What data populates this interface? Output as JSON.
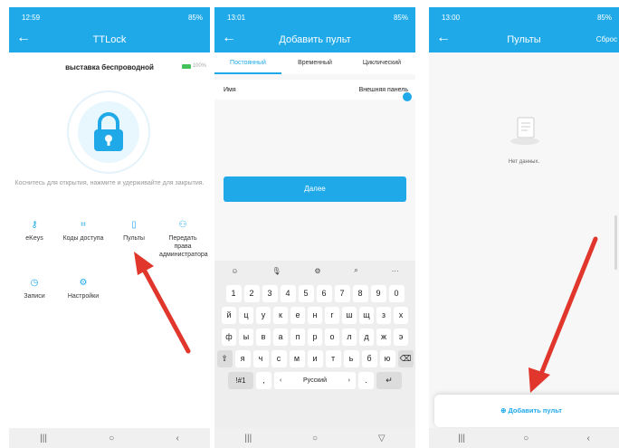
{
  "panel1": {
    "status": {
      "time": "12:59",
      "battery": "85%"
    },
    "appbar": {
      "title": "TTLock"
    },
    "lock_name": "выставка беспроводной",
    "battery_level": "100%",
    "hint": "Коснитесь для открытия, нажмите и удерживайте для закрытия.",
    "menu": [
      {
        "label": "eKeys",
        "icon": "key-icon"
      },
      {
        "label": "Коды доступа",
        "icon": "keypad-icon"
      },
      {
        "label": "Пульты",
        "icon": "remote-icon"
      },
      {
        "label": "Передать права администратора",
        "icon": "transfer-admin-icon"
      },
      {
        "label": "Записи",
        "icon": "history-icon"
      },
      {
        "label": "Настройки",
        "icon": "gear-icon"
      }
    ]
  },
  "panel2": {
    "status": {
      "time": "13:01",
      "battery": "85%"
    },
    "appbar": {
      "title": "Добавить пульт"
    },
    "tabs": [
      "Постоянный",
      "Временный",
      "Циклический"
    ],
    "name_label": "Имя",
    "name_value": "Внешняя панель",
    "next_button": "Далее",
    "keyboard": {
      "row1": [
        "1",
        "2",
        "3",
        "4",
        "5",
        "6",
        "7",
        "8",
        "9",
        "0"
      ],
      "row2": [
        "й",
        "ц",
        "у",
        "к",
        "е",
        "н",
        "г",
        "ш",
        "щ",
        "з",
        "х"
      ],
      "row3": [
        "ф",
        "ы",
        "в",
        "а",
        "п",
        "р",
        "о",
        "л",
        "д",
        "ж",
        "э"
      ],
      "row4": [
        "я",
        "ч",
        "с",
        "м",
        "и",
        "т",
        "ь",
        "б",
        "ю"
      ],
      "symbols": "!#1",
      "comma": ",",
      "space": "Русский",
      "period": "."
    }
  },
  "panel3": {
    "status": {
      "time": "13:00",
      "battery": "85%"
    },
    "appbar": {
      "title": "Пульты",
      "action": "Сброс"
    },
    "empty_text": "Нет данных.",
    "add_button": "Добавить пульт"
  },
  "colors": {
    "accent": "#1fa9e9",
    "arrow": "#e0362c"
  }
}
